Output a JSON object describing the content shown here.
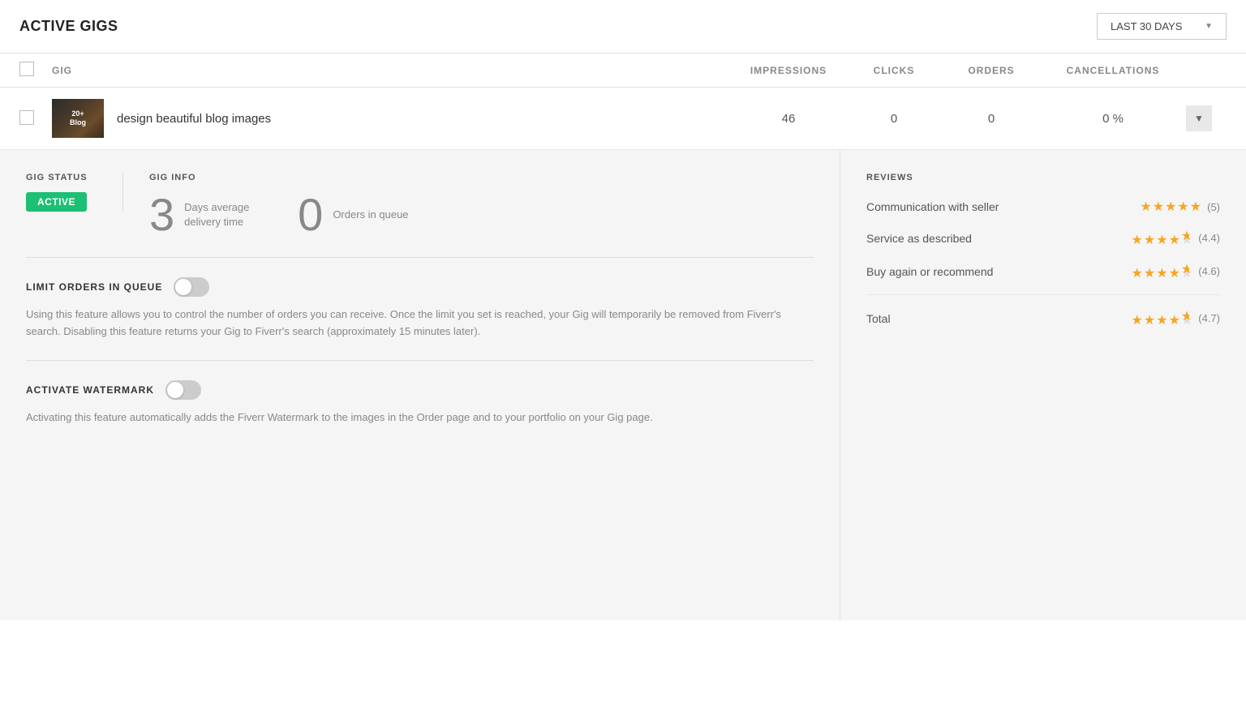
{
  "header": {
    "title": "ACTIVE GIGS",
    "date_filter": "LAST 30 DAYS"
  },
  "table": {
    "columns": {
      "gig": "GIG",
      "impressions": "IMPRESSIONS",
      "clicks": "CLICKS",
      "orders": "ORDERS",
      "cancellations": "CANCELLATIONS"
    },
    "gig": {
      "name": "design beautiful blog images",
      "impressions": "46",
      "clicks": "0",
      "orders": "0",
      "cancellations": "0 %"
    }
  },
  "details": {
    "status_label": "GIG STATUS",
    "status_value": "ACTIVE",
    "info_label": "GIG INFO",
    "delivery_num": "3",
    "delivery_text": "Days average delivery time",
    "queue_num": "0",
    "queue_text": "Orders in queue",
    "limit_orders_label": "LIMIT ORDERS IN QUEUE",
    "limit_orders_desc": "Using this feature allows you to control the number of orders you can receive. Once the limit you set is reached, your Gig will temporarily be removed from Fiverr's search. Disabling this feature returns your Gig to Fiverr's search (approximately 15 minutes later).",
    "watermark_label": "ACTIVATE WATERMARK",
    "watermark_desc": "Activating this feature automatically adds the Fiverr Watermark to the images in the Order page and to your portfolio on your Gig page."
  },
  "reviews": {
    "label": "REVIEWS",
    "items": [
      {
        "category": "Communication with seller",
        "score": "(5)"
      },
      {
        "category": "Service as described",
        "score": "(4.4)"
      },
      {
        "category": "Buy again or recommend",
        "score": "(4.6)"
      }
    ],
    "total_label": "Total",
    "total_score": "(4.7)"
  }
}
